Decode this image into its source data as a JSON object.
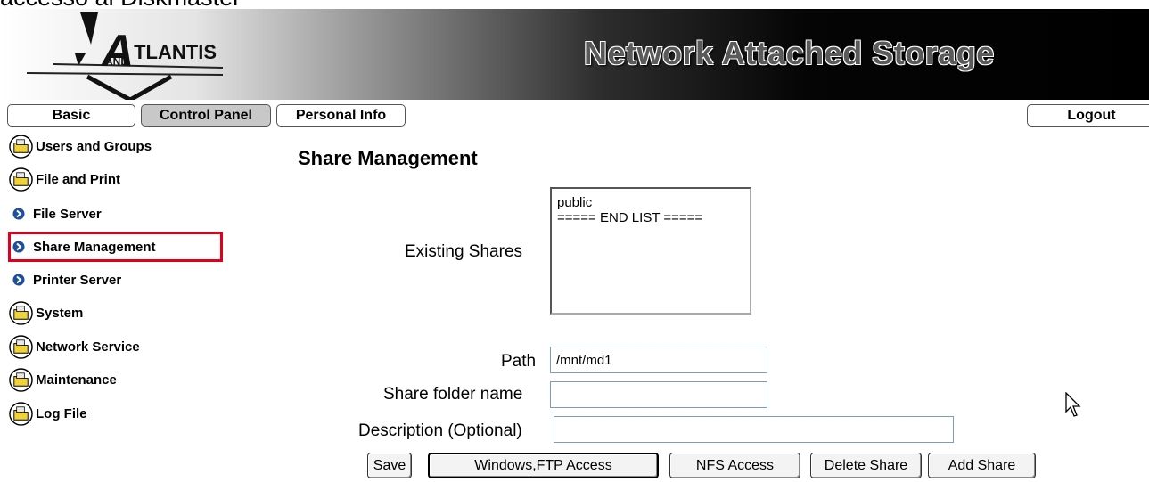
{
  "caption": "accesso al Diskmaster",
  "header": {
    "logo_text": "TLANTIS",
    "logo_sub": "AND",
    "title": "Network Attached Storage"
  },
  "tabs": [
    {
      "label": "Basic",
      "active": false
    },
    {
      "label": "Control Panel",
      "active": true
    },
    {
      "label": "Personal Info",
      "active": false
    }
  ],
  "logout_label": "Logout",
  "sidebar": {
    "items": [
      {
        "label": "Users and Groups",
        "icon": "folder-icon"
      },
      {
        "label": "File and Print",
        "icon": "folder-icon"
      },
      {
        "label": "File Server",
        "icon": "bullet-icon"
      },
      {
        "label": "Share Management",
        "icon": "bullet-icon",
        "selected": true
      },
      {
        "label": "Printer Server",
        "icon": "bullet-icon"
      },
      {
        "label": "System",
        "icon": "folder-icon"
      },
      {
        "label": "Network Service",
        "icon": "folder-icon"
      },
      {
        "label": "Maintenance",
        "icon": "folder-icon"
      },
      {
        "label": "Log File",
        "icon": "folder-icon"
      }
    ]
  },
  "main": {
    "title": "Share Management",
    "existing_shares_label": "Existing Shares",
    "existing_shares": [
      "public",
      "===== END LIST ====="
    ],
    "path_label": "Path",
    "path_value": "/mnt/md1",
    "share_folder_label": "Share folder name",
    "share_folder_value": "",
    "description_label": "Description (Optional)",
    "description_value": "",
    "buttons": {
      "save": "Save",
      "windows_ftp": "Windows,FTP Access",
      "nfs": "NFS Access",
      "delete": "Delete Share",
      "add": "Add Share"
    }
  },
  "colors": {
    "highlight": "#e0001b",
    "bullet": "#1f4e9c",
    "folder": "#f2d23a"
  }
}
